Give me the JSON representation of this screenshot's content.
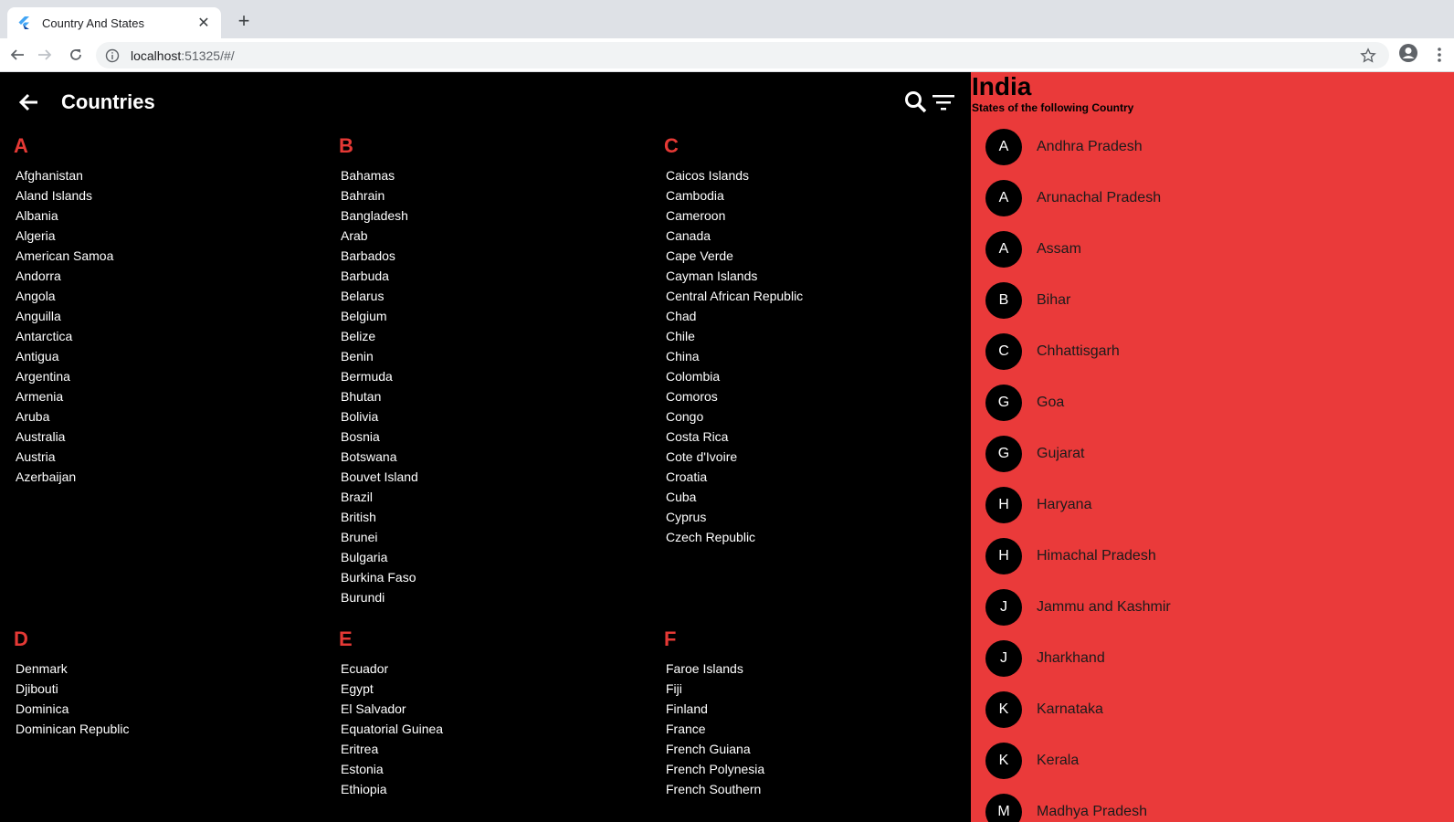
{
  "browser": {
    "tab_title": "Country And States",
    "url_host": "localhost",
    "url_rest": ":51325/#/"
  },
  "appbar": {
    "title": "Countries"
  },
  "groups": [
    {
      "letter": "A",
      "countries": [
        "Afghanistan",
        "Aland Islands",
        "Albania",
        "Algeria",
        "American Samoa",
        "Andorra",
        "Angola",
        "Anguilla",
        "Antarctica",
        "Antigua",
        "Argentina",
        "Armenia",
        "Aruba",
        "Australia",
        "Austria",
        "Azerbaijan"
      ]
    },
    {
      "letter": "B",
      "countries": [
        "Bahamas",
        "Bahrain",
        "Bangladesh",
        "Arab",
        "Barbados",
        "Barbuda",
        "Belarus",
        "Belgium",
        "Belize",
        "Benin",
        "Bermuda",
        "Bhutan",
        "Bolivia",
        "Bosnia",
        "Botswana",
        "Bouvet Island",
        "Brazil",
        "British",
        "Brunei",
        "Bulgaria",
        "Burkina Faso",
        "Burundi"
      ]
    },
    {
      "letter": "C",
      "countries": [
        "Caicos Islands",
        "Cambodia",
        "Cameroon",
        "Canada",
        "Cape Verde",
        "Cayman Islands",
        "Central African Republic",
        "Chad",
        "Chile",
        "China",
        "Colombia",
        "Comoros",
        "Congo",
        "Costa Rica",
        "Cote d'Ivoire",
        "Croatia",
        "Cuba",
        "Cyprus",
        "Czech Republic"
      ]
    },
    {
      "letter": "D",
      "countries": [
        "Denmark",
        "Djibouti",
        "Dominica",
        "Dominican Republic"
      ]
    },
    {
      "letter": "E",
      "countries": [
        "Ecuador",
        "Egypt",
        "El Salvador",
        "Equatorial Guinea",
        "Eritrea",
        "Estonia",
        "Ethiopia"
      ]
    },
    {
      "letter": "F",
      "countries": [
        "Faroe Islands",
        "Fiji",
        "Finland",
        "France",
        "French Guiana",
        "French Polynesia",
        "French Southern"
      ]
    }
  ],
  "detail": {
    "country": "India",
    "subtitle": "States of the following Country",
    "states": [
      {
        "initial": "A",
        "name": "Andhra Pradesh"
      },
      {
        "initial": "A",
        "name": "Arunachal Pradesh"
      },
      {
        "initial": "A",
        "name": "Assam"
      },
      {
        "initial": "B",
        "name": "Bihar"
      },
      {
        "initial": "C",
        "name": "Chhattisgarh"
      },
      {
        "initial": "G",
        "name": "Goa"
      },
      {
        "initial": "G",
        "name": "Gujarat"
      },
      {
        "initial": "H",
        "name": "Haryana"
      },
      {
        "initial": "H",
        "name": "Himachal Pradesh"
      },
      {
        "initial": "J",
        "name": "Jammu and Kashmir"
      },
      {
        "initial": "J",
        "name": "Jharkhand"
      },
      {
        "initial": "K",
        "name": "Karnataka"
      },
      {
        "initial": "K",
        "name": "Kerala"
      },
      {
        "initial": "M",
        "name": "Madhya Pradesh"
      }
    ]
  },
  "colors": {
    "accent": "#e53935",
    "panel": "#ea3a3a"
  }
}
